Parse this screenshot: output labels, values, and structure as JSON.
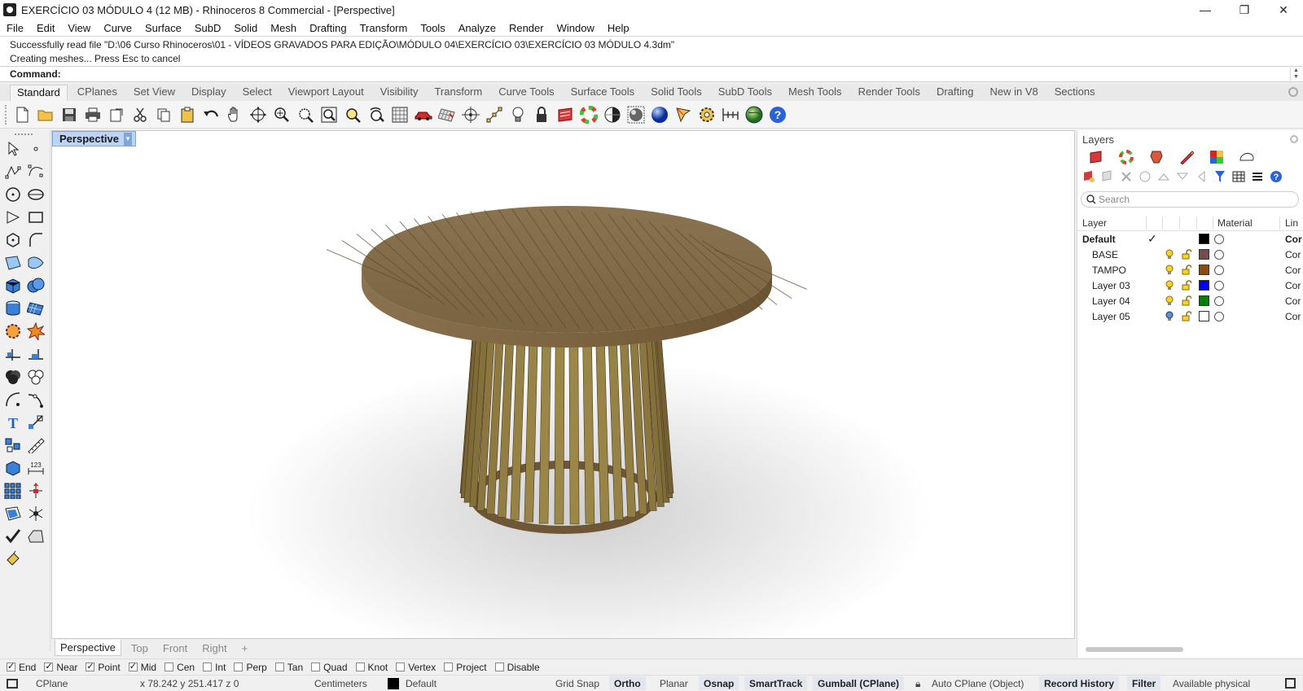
{
  "window": {
    "title": "EXERCÍCIO 03 MÓDULO 4 (12 MB) - Rhinoceros 8 Commercial - [Perspective]",
    "minimize": "—",
    "maximize": "❐",
    "close": "✕"
  },
  "menu": [
    "File",
    "Edit",
    "View",
    "Curve",
    "Surface",
    "SubD",
    "Solid",
    "Mesh",
    "Drafting",
    "Transform",
    "Tools",
    "Analyze",
    "Render",
    "Window",
    "Help"
  ],
  "history": {
    "line1": "Successfully read file \"D:\\06 Curso Rhinoceros\\01 - VÍDEOS GRAVADOS PARA EDIÇÃO\\MÓDULO 04\\EXERCÍCIO 03\\EXERCÍCIO 03 MÓDULO 4.3dm\"",
    "line2": "Creating meshes... Press Esc to cancel"
  },
  "command": {
    "label": "Command:",
    "value": ""
  },
  "tabs": [
    "Standard",
    "CPlanes",
    "Set View",
    "Display",
    "Select",
    "Viewport Layout",
    "Visibility",
    "Transform",
    "Curve Tools",
    "Surface Tools",
    "Solid Tools",
    "SubD Tools",
    "Mesh Tools",
    "Render Tools",
    "Drafting",
    "New in V8",
    "Sections"
  ],
  "active_tab": "Standard",
  "toolbar_icons": [
    "new-icon",
    "open-icon",
    "save-icon",
    "print-icon",
    "import-icon",
    "cut-icon",
    "copy-icon",
    "paste-icon",
    "undo-icon",
    "pan-icon",
    "rotate-view-icon",
    "zoom-icon",
    "zoom-window-icon",
    "zoom-extents-icon",
    "zoom-selected-icon",
    "undo-view-icon",
    "viewport-layout-icon",
    "car-icon",
    "grid-icon",
    "snap-icon",
    "select-points-icon",
    "light-icon",
    "lock-icon",
    "layer-icon",
    "color-wheel-icon",
    "shaded-icon",
    "rendered-icon",
    "sphere-icon",
    "pen-icon",
    "gear-icon",
    "dimension-icon",
    "globe-icon",
    "help-icon"
  ],
  "viewport": {
    "name": "Perspective",
    "tabs": [
      "Perspective",
      "Top",
      "Front",
      "Right"
    ],
    "add_tab": "+"
  },
  "layers_panel": {
    "title": "Layers",
    "search_placeholder": "Search",
    "columns": {
      "layer": "Layer",
      "material": "Material",
      "linetype": "Lin"
    },
    "rows": [
      {
        "name": "Default",
        "current": true,
        "color": "#000000",
        "linetype": "Cor"
      },
      {
        "name": "BASE",
        "current": false,
        "color": "#7a4b4b",
        "linetype": "Cor"
      },
      {
        "name": "TAMPO",
        "current": false,
        "color": "#8b4a10",
        "linetype": "Cor"
      },
      {
        "name": "Layer 03",
        "current": false,
        "color": "#0000ff",
        "linetype": "Cor"
      },
      {
        "name": "Layer 04",
        "current": false,
        "color": "#008000",
        "linetype": "Cor"
      },
      {
        "name": "Layer 05",
        "current": false,
        "color": "#ffffff",
        "linetype": "Cor"
      }
    ]
  },
  "osnaps": [
    {
      "label": "End",
      "on": true
    },
    {
      "label": "Near",
      "on": true
    },
    {
      "label": "Point",
      "on": true
    },
    {
      "label": "Mid",
      "on": true
    },
    {
      "label": "Cen",
      "on": false
    },
    {
      "label": "Int",
      "on": false
    },
    {
      "label": "Perp",
      "on": false
    },
    {
      "label": "Tan",
      "on": false
    },
    {
      "label": "Quad",
      "on": false
    },
    {
      "label": "Knot",
      "on": false
    },
    {
      "label": "Vertex",
      "on": false
    },
    {
      "label": "Project",
      "on": false
    },
    {
      "label": "Disable",
      "on": false
    }
  ],
  "status": {
    "cplane": "CPlane",
    "coords": "x 78.242   y 251.417   z 0",
    "units": "Centimeters",
    "layer": "Default",
    "grid_snap": "Grid Snap",
    "ortho": "Ortho",
    "planar": "Planar",
    "osnap": "Osnap",
    "smarttrack": "SmartTrack",
    "gumball": "Gumball (CPlane)",
    "auto_cplane": "Auto CPlane (Object)",
    "record_history": "Record History",
    "filter": "Filter",
    "memory": "Available physical"
  }
}
